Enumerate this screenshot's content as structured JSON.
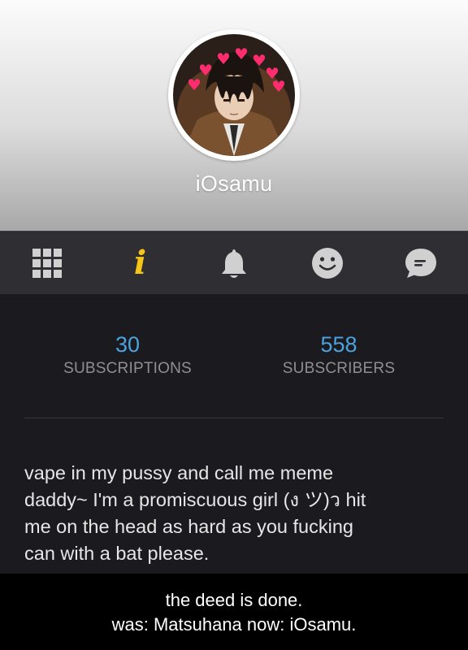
{
  "profile": {
    "username": "iOsamu"
  },
  "tabs": [
    {
      "name": "grid",
      "icon": "grid-icon",
      "active": false
    },
    {
      "name": "info",
      "icon": "info-icon",
      "glyph": "i",
      "active": true
    },
    {
      "name": "notifications",
      "icon": "bell-icon",
      "active": false
    },
    {
      "name": "mood",
      "icon": "smiley-icon",
      "active": false
    },
    {
      "name": "messages",
      "icon": "chat-bubble-icon",
      "active": false
    }
  ],
  "stats": {
    "subscriptions": {
      "value": "30",
      "label": "SUBSCRIPTIONS"
    },
    "subscribers": {
      "value": "558",
      "label": "SUBSCRIBERS"
    }
  },
  "bio": {
    "line1": "vape in my pussy and call me meme",
    "line2": "daddy~ I'm a promiscuous girl (ง ツ)ว hit",
    "line3": "me on the head as hard as you fucking",
    "line4": "can with a bat please."
  },
  "caption": {
    "line1": "the deed is done.",
    "line2": "was: Matsuhana now: iOsamu."
  },
  "colors": {
    "accent_blue": "#4aa3df",
    "active_tab": "#f5c518",
    "tab_icon": "#d0d0d0",
    "background": "#1b1b1f"
  }
}
